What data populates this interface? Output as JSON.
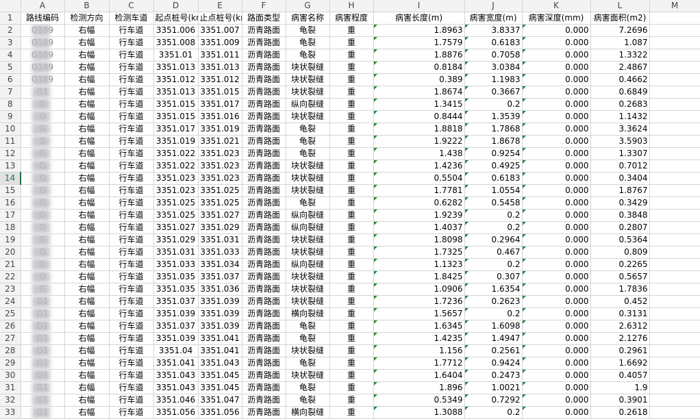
{
  "columns": [
    "A",
    "B",
    "C",
    "D",
    "E",
    "F",
    "G",
    "H",
    "I",
    "J",
    "K",
    "L",
    "M"
  ],
  "header_row_num": "1",
  "headers": [
    "路线编码",
    "检测方向",
    "检测车道",
    "起点桩号(km",
    "止点桩号(km",
    "路面类型",
    "病害名称",
    "病害程度",
    "病害长度(m)",
    "病害宽度(m)",
    "病害深度(mm)",
    "病害面积(m2)",
    ""
  ],
  "selected_row": "14",
  "rows": [
    {
      "n": "2",
      "a": "G189",
      "b": "右幅",
      "c": "行车道",
      "d": "3351.006",
      "e": "3351.007",
      "f": "沥青路面",
      "g": "龟裂",
      "h": "重",
      "i": "1.8963",
      "j": "3.8337",
      "k": "0.000",
      "l": "7.2696"
    },
    {
      "n": "3",
      "a": "G189",
      "b": "右幅",
      "c": "行车道",
      "d": "3351.008",
      "e": "3351.009",
      "f": "沥青路面",
      "g": "龟裂",
      "h": "重",
      "i": "1.7579",
      "j": "0.6183",
      "k": "0.000",
      "l": "1.087"
    },
    {
      "n": "4",
      "a": "G189",
      "b": "右幅",
      "c": "行车道",
      "d": "3351.01",
      "e": "3351.011",
      "f": "沥青路面",
      "g": "龟裂",
      "h": "重",
      "i": "1.8876",
      "j": "0.7058",
      "k": "0.000",
      "l": "1.3322"
    },
    {
      "n": "5",
      "a": "G189",
      "b": "右幅",
      "c": "行车道",
      "d": "3351.013",
      "e": "3351.013",
      "f": "沥青路面",
      "g": "块状裂缝",
      "h": "重",
      "i": "0.8184",
      "j": "3.0384",
      "k": "0.000",
      "l": "2.4867"
    },
    {
      "n": "6",
      "a": "G189",
      "b": "右幅",
      "c": "行车道",
      "d": "3351.012",
      "e": "3351.012",
      "f": "沥青路面",
      "g": "块状裂缝",
      "h": "重",
      "i": "0.389",
      "j": "1.1983",
      "k": "0.000",
      "l": "0.4662"
    },
    {
      "n": "7",
      "a": "G1",
      "b": "右幅",
      "c": "行车道",
      "d": "3351.013",
      "e": "3351.015",
      "f": "沥青路面",
      "g": "块状裂缝",
      "h": "重",
      "i": "1.8674",
      "j": "0.3667",
      "k": "0.000",
      "l": "0.6849"
    },
    {
      "n": "8",
      "a": "G",
      "b": "右幅",
      "c": "行车道",
      "d": "3351.015",
      "e": "3351.017",
      "f": "沥青路面",
      "g": "纵向裂缝",
      "h": "重",
      "i": "1.3415",
      "j": "0.2",
      "k": "0.000",
      "l": "0.2683"
    },
    {
      "n": "9",
      "a": "G",
      "b": "右幅",
      "c": "行车道",
      "d": "3351.015",
      "e": "3351.016",
      "f": "沥青路面",
      "g": "块状裂缝",
      "h": "重",
      "i": "0.8444",
      "j": "1.3539",
      "k": "0.000",
      "l": "1.1432"
    },
    {
      "n": "10",
      "a": "G",
      "b": "右幅",
      "c": "行车道",
      "d": "3351.017",
      "e": "3351.019",
      "f": "沥青路面",
      "g": "龟裂",
      "h": "重",
      "i": "1.8818",
      "j": "1.7868",
      "k": "0.000",
      "l": "3.3624"
    },
    {
      "n": "11",
      "a": "G",
      "b": "右幅",
      "c": "行车道",
      "d": "3351.019",
      "e": "3351.021",
      "f": "沥青路面",
      "g": "龟裂",
      "h": "重",
      "i": "1.9222",
      "j": "1.8678",
      "k": "0.000",
      "l": "3.5903"
    },
    {
      "n": "12",
      "a": "G",
      "b": "右幅",
      "c": "行车道",
      "d": "3351.022",
      "e": "3351.023",
      "f": "沥青路面",
      "g": "龟裂",
      "h": "重",
      "i": "1.438",
      "j": "0.9254",
      "k": "0.000",
      "l": "1.3307"
    },
    {
      "n": "13",
      "a": "G",
      "b": "右幅",
      "c": "行车道",
      "d": "3351.022",
      "e": "3351.023",
      "f": "沥青路面",
      "g": "块状裂缝",
      "h": "重",
      "i": "1.4236",
      "j": "0.4925",
      "k": "0.000",
      "l": "0.7012"
    },
    {
      "n": "14",
      "a": "G",
      "b": "右幅",
      "c": "行车道",
      "d": "3351.023",
      "e": "3351.023",
      "f": "沥青路面",
      "g": "块状裂缝",
      "h": "重",
      "i": "0.5504",
      "j": "0.6183",
      "k": "0.000",
      "l": "0.3404"
    },
    {
      "n": "15",
      "a": "G",
      "b": "右幅",
      "c": "行车道",
      "d": "3351.023",
      "e": "3351.025",
      "f": "沥青路面",
      "g": "块状裂缝",
      "h": "重",
      "i": "1.7781",
      "j": "1.0554",
      "k": "0.000",
      "l": "1.8767"
    },
    {
      "n": "16",
      "a": "G",
      "b": "右幅",
      "c": "行车道",
      "d": "3351.025",
      "e": "3351.025",
      "f": "沥青路面",
      "g": "龟裂",
      "h": "重",
      "i": "0.6282",
      "j": "0.5458",
      "k": "0.000",
      "l": "0.3429"
    },
    {
      "n": "17",
      "a": "G",
      "b": "右幅",
      "c": "行车道",
      "d": "3351.025",
      "e": "3351.027",
      "f": "沥青路面",
      "g": "纵向裂缝",
      "h": "重",
      "i": "1.9239",
      "j": "0.2",
      "k": "0.000",
      "l": "0.3848"
    },
    {
      "n": "18",
      "a": "G",
      "b": "右幅",
      "c": "行车道",
      "d": "3351.027",
      "e": "3351.029",
      "f": "沥青路面",
      "g": "纵向裂缝",
      "h": "重",
      "i": "1.4037",
      "j": "0.2",
      "k": "0.000",
      "l": "0.2807"
    },
    {
      "n": "19",
      "a": "G",
      "b": "右幅",
      "c": "行车道",
      "d": "3351.029",
      "e": "3351.031",
      "f": "沥青路面",
      "g": "块状裂缝",
      "h": "重",
      "i": "1.8098",
      "j": "0.2964",
      "k": "0.000",
      "l": "0.5364"
    },
    {
      "n": "20",
      "a": "G",
      "b": "右幅",
      "c": "行车道",
      "d": "3351.031",
      "e": "3351.033",
      "f": "沥青路面",
      "g": "块状裂缝",
      "h": "重",
      "i": "1.7325",
      "j": "0.467",
      "k": "0.000",
      "l": "0.809"
    },
    {
      "n": "21",
      "a": "G",
      "b": "右幅",
      "c": "行车道",
      "d": "3351.033",
      "e": "3351.034",
      "f": "沥青路面",
      "g": "纵向裂缝",
      "h": "重",
      "i": "1.1323",
      "j": "0.2",
      "k": "0.000",
      "l": "0.2265"
    },
    {
      "n": "22",
      "a": "G",
      "b": "右幅",
      "c": "行车道",
      "d": "3351.035",
      "e": "3351.037",
      "f": "沥青路面",
      "g": "块状裂缝",
      "h": "重",
      "i": "1.8425",
      "j": "0.307",
      "k": "0.000",
      "l": "0.5657"
    },
    {
      "n": "23",
      "a": "G",
      "b": "右幅",
      "c": "行车道",
      "d": "3351.035",
      "e": "3351.036",
      "f": "沥青路面",
      "g": "块状裂缝",
      "h": "重",
      "i": "1.0906",
      "j": "1.6354",
      "k": "0.000",
      "l": "1.7836"
    },
    {
      "n": "24",
      "a": "G1",
      "b": "右幅",
      "c": "行车道",
      "d": "3351.037",
      "e": "3351.039",
      "f": "沥青路面",
      "g": "块状裂缝",
      "h": "重",
      "i": "1.7236",
      "j": "0.2623",
      "k": "0.000",
      "l": "0.452"
    },
    {
      "n": "25",
      "a": "G1",
      "b": "右幅",
      "c": "行车道",
      "d": "3351.039",
      "e": "3351.039",
      "f": "沥青路面",
      "g": "横向裂缝",
      "h": "重",
      "i": "1.5657",
      "j": "0.2",
      "k": "0.000",
      "l": "0.3131"
    },
    {
      "n": "26",
      "a": "G1",
      "b": "右幅",
      "c": "行车道",
      "d": "3351.037",
      "e": "3351.039",
      "f": "沥青路面",
      "g": "龟裂",
      "h": "重",
      "i": "1.6345",
      "j": "1.6098",
      "k": "0.000",
      "l": "2.6312"
    },
    {
      "n": "27",
      "a": "G1",
      "b": "右幅",
      "c": "行车道",
      "d": "3351.039",
      "e": "3351.041",
      "f": "沥青路面",
      "g": "龟裂",
      "h": "重",
      "i": "1.4235",
      "j": "1.4947",
      "k": "0.000",
      "l": "2.1276"
    },
    {
      "n": "28",
      "a": "G1",
      "b": "右幅",
      "c": "行车道",
      "d": "3351.04",
      "e": "3351.041",
      "f": "沥青路面",
      "g": "块状裂缝",
      "h": "重",
      "i": "1.156",
      "j": "0.2561",
      "k": "0.000",
      "l": "0.2961"
    },
    {
      "n": "29",
      "a": "G1",
      "b": "右幅",
      "c": "行车道",
      "d": "3351.041",
      "e": "3351.043",
      "f": "沥青路面",
      "g": "龟裂",
      "h": "重",
      "i": "1.7712",
      "j": "0.9424",
      "k": "0.000",
      "l": "1.6692"
    },
    {
      "n": "30",
      "a": "G1",
      "b": "右幅",
      "c": "行车道",
      "d": "3351.043",
      "e": "3351.045",
      "f": "沥青路面",
      "g": "块状裂缝",
      "h": "重",
      "i": "1.6404",
      "j": "0.2473",
      "k": "0.000",
      "l": "0.4057"
    },
    {
      "n": "31",
      "a": "G1",
      "b": "右幅",
      "c": "行车道",
      "d": "3351.043",
      "e": "3351.045",
      "f": "沥青路面",
      "g": "龟裂",
      "h": "重",
      "i": "1.896",
      "j": "1.0021",
      "k": "0.000",
      "l": "1.9"
    },
    {
      "n": "32",
      "a": "G1",
      "b": "右幅",
      "c": "行车道",
      "d": "3351.046",
      "e": "3351.047",
      "f": "沥青路面",
      "g": "龟裂",
      "h": "重",
      "i": "0.5349",
      "j": "0.7292",
      "k": "0.000",
      "l": "0.3901"
    },
    {
      "n": "33",
      "a": "G1",
      "b": "右幅",
      "c": "行车道",
      "d": "3351.056",
      "e": "3351.056",
      "f": "沥青路面",
      "g": "横向裂缝",
      "h": "重",
      "i": "1.3088",
      "j": "0.2",
      "k": "0.000",
      "l": "0.2618"
    }
  ]
}
